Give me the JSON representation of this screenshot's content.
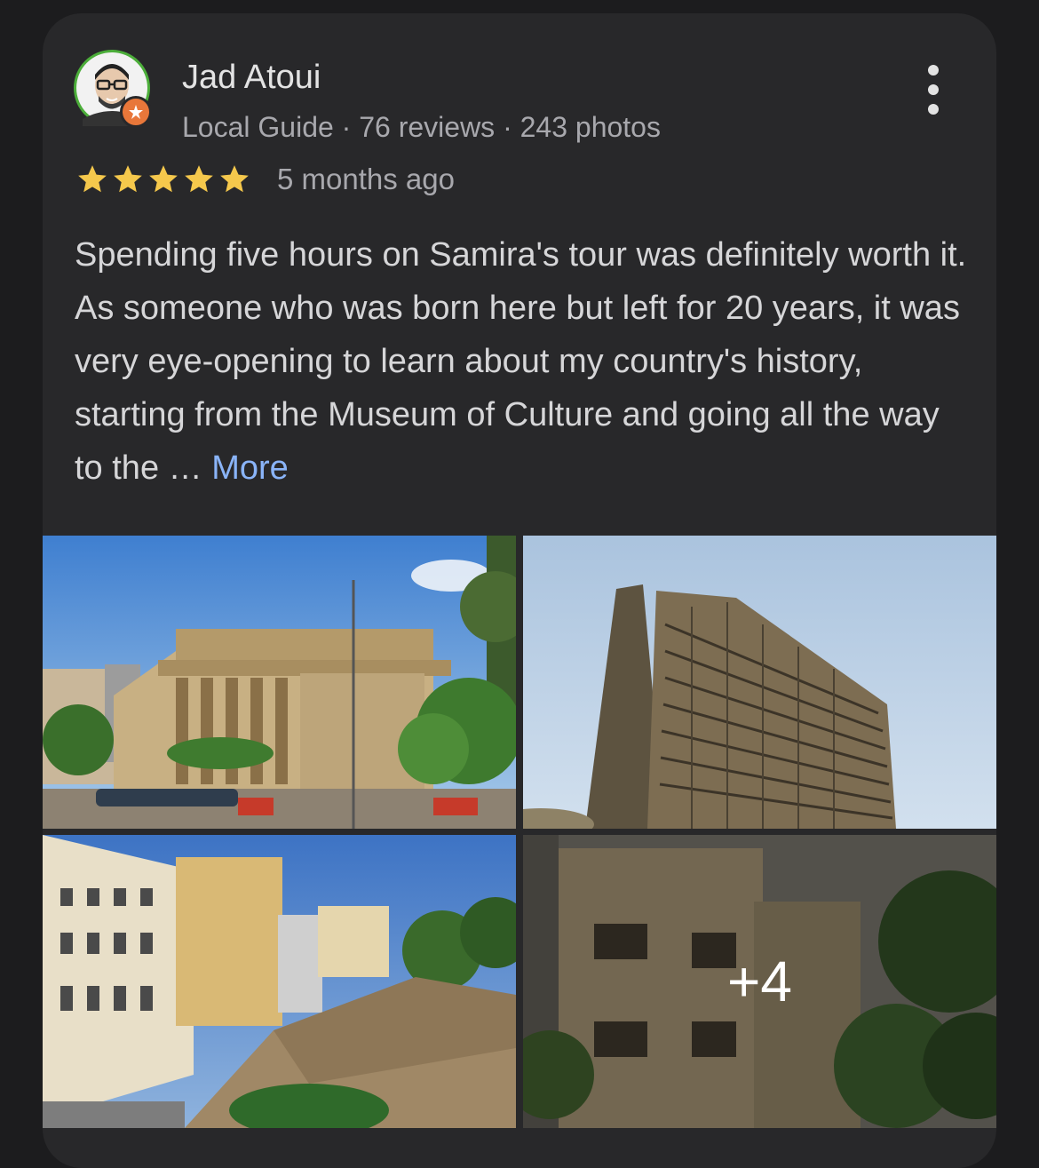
{
  "reviewer": {
    "name": "Jad Atoui",
    "meta": "Local Guide · 76 reviews · 243 photos"
  },
  "rating": {
    "stars": 5,
    "max": 5,
    "time_ago": "5 months ago"
  },
  "review": {
    "text": "Spending five hours on Samira's tour was definitely worth it. As someone who was born here but left for 20 years, it was very eye-opening to learn about my country's history, starting from the Museum of Culture and going all the way to the … ",
    "more_label": "More"
  },
  "photos": {
    "more_count": "+4"
  },
  "colors": {
    "card_bg": "#28282a",
    "star": "#f5c84c",
    "link": "#8ab4f8",
    "badge": "#e8773a"
  },
  "icons": [
    "avatar",
    "local-guide-badge-icon",
    "more-vert-icon",
    "star-icon"
  ]
}
